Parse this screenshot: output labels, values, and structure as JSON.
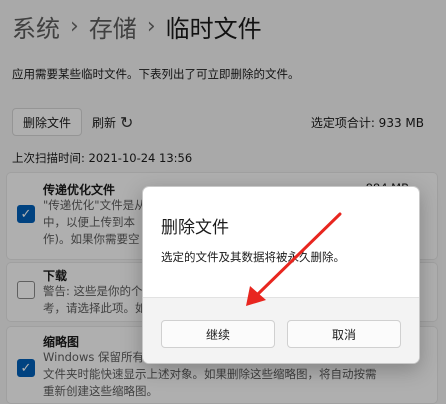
{
  "breadcrumb": {
    "parts": [
      "系统",
      "存储",
      "临时文件"
    ],
    "separator": "›"
  },
  "description": "应用需要某些临时文件。下表列出了可立即删除的文件。",
  "toolbar": {
    "delete_label": "删除文件",
    "refresh_label": "刷新",
    "refresh_icon": "refresh-icon",
    "total_label": "选定项合计: 933 MB"
  },
  "last_scan": "上次扫描时间: 2021-10-24 13:56",
  "categories": [
    {
      "title": "传递优化文件",
      "size": "884 MB",
      "checked": true,
      "lines": [
        "\"传递优化\"文件是从以",
        "中，以便上传到本",
        "作)。如果你需要空"
      ]
    },
    {
      "title": "下载",
      "size": "",
      "checked": false,
      "lines": [
        "警告: 这些是你的个",
        "考，请选择此项。如"
      ]
    },
    {
      "title": "缩略图",
      "size": "",
      "checked": true,
      "lines": [
        "Windows 保留所有",
        "文件夹时能快速显示上述对象。如果删除这些缩略图，将自动按需",
        "重新创建这些缩略图。"
      ]
    }
  ],
  "dialog": {
    "title": "删除文件",
    "message": "选定的文件及其数据将被永久删除。",
    "continue_label": "继续",
    "cancel_label": "取消"
  },
  "annotation": {
    "color": "#e8261f"
  }
}
